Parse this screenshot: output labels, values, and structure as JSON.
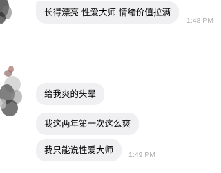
{
  "conversation": {
    "messages": [
      {
        "text": "长得漂亮 性爱大师 情绪价值拉满",
        "time": "1:48 PM"
      },
      {
        "text": "给我爽的头晕",
        "time": ""
      },
      {
        "text": "我这两年第一次这么爽",
        "time": ""
      },
      {
        "text": "我只能说性爱大师",
        "time": "1:49 PM"
      }
    ]
  },
  "colors": {
    "bubble_bg": "#f0f0f2",
    "timestamp": "#a8a8a8",
    "text": "#000000"
  },
  "icons": [
    "contact-avatar"
  ]
}
